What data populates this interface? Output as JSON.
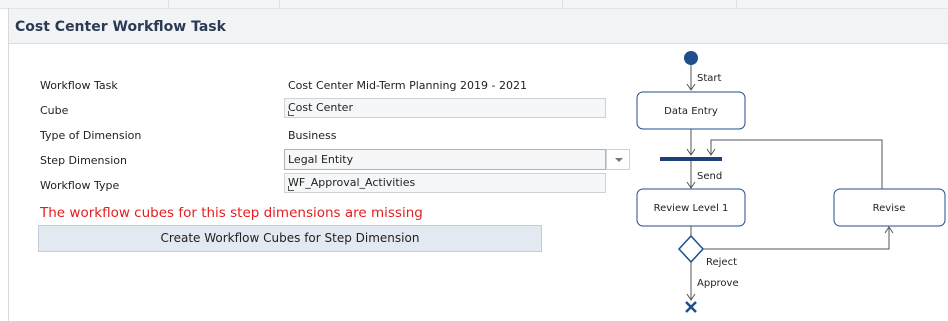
{
  "header": {
    "title": "Cost Center Workflow Task"
  },
  "form": {
    "workflow_task": {
      "label": "Workflow Task",
      "value": "Cost Center Mid-Term Planning 2019 - 2021"
    },
    "cube": {
      "label": "Cube",
      "value": "Cost Center"
    },
    "type_of_dimension": {
      "label": "Type of Dimension",
      "value": "Business"
    },
    "step_dimension": {
      "label": "Step Dimension",
      "value": "Legal Entity"
    },
    "workflow_type": {
      "label": "Workflow Type",
      "value": "WF_Approval_Activities"
    }
  },
  "error": "The workflow cubes for this step dimensions are missing",
  "create_button": "Create Workflow Cubes for Step Dimension",
  "diagram": {
    "start": "Start",
    "data_entry": "Data Entry",
    "send": "Send",
    "review_level_1": "Review Level 1",
    "revise": "Revise",
    "reject": "Reject",
    "approve": "Approve"
  },
  "colors": {
    "error": "#e41e1e",
    "node_border": "#1f4e8c",
    "start_node": "#1f4e8c"
  }
}
